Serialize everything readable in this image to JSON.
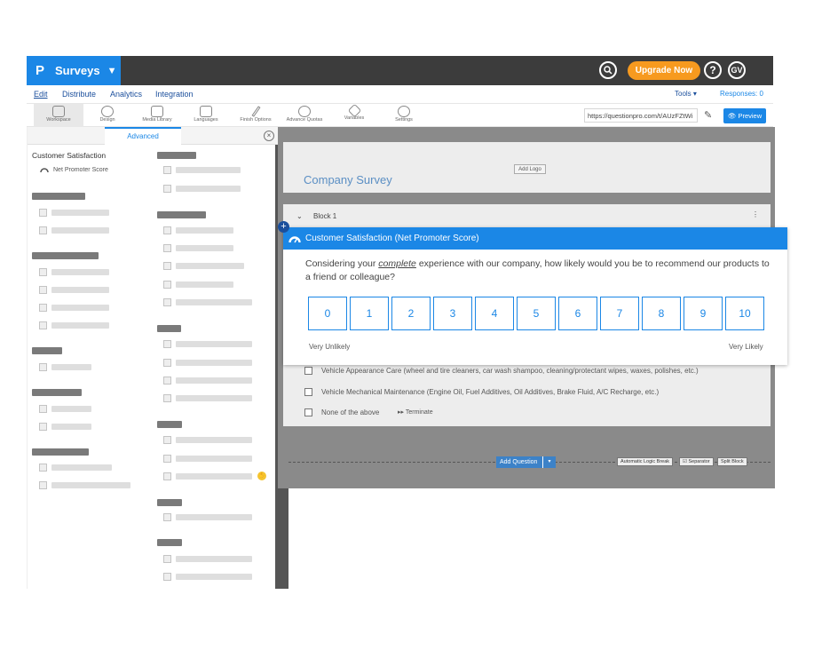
{
  "topbar": {
    "logo_letter": "P",
    "app_name": "Surveys",
    "upgrade_label": "Upgrade Now",
    "help_label": "?",
    "avatar_initials": "GV"
  },
  "nav": {
    "items": [
      "Edit",
      "Distribute",
      "Analytics",
      "Integration"
    ],
    "tools_label": "Tools",
    "responses_label": "Responses: 0"
  },
  "toolbar": {
    "items": [
      "Workspace",
      "Design",
      "Media Library",
      "Languages",
      "Finish Options",
      "Advance Quotas",
      "Variables",
      "Settings"
    ],
    "url": "https://questionpro.com/t/AUzFZtWi",
    "preview_label": "Preview"
  },
  "left_panel": {
    "tab_label": "Advanced",
    "category": "Customer Satisfaction",
    "category_item": "Net Promoter Score"
  },
  "editor": {
    "add_logo_label": "Add Logo",
    "survey_title": "Company Survey",
    "block_label": "Block 1",
    "options": [
      "Vehicle Appearance Care (wheel and tire cleaners, car wash shampoo, cleaning/protectant wipes, waxes, polishes, etc.)",
      "Vehicle Mechanical Maintenance (Engine Oil, Fuel Additives, Oil Additives, Brake Fluid, A/C Recharge, etc.)",
      "None of the above"
    ],
    "terminate_label": "Terminate",
    "add_question_label": "Add Question",
    "logic_break_label": "Automatic Logic Break",
    "separator_label": "Separator",
    "split_block_label": "Split Block"
  },
  "nps_card": {
    "header": "Customer Satisfaction (Net Promoter Score)",
    "question_before": "Considering your ",
    "question_emph": "complete",
    "question_after": " experience with our company, how likely would you be to recommend our products to a friend or colleague?",
    "scale": [
      "0",
      "1",
      "2",
      "3",
      "4",
      "5",
      "6",
      "7",
      "8",
      "9",
      "10"
    ],
    "low_anchor": "Very Unlikely",
    "high_anchor": "Very Likely"
  },
  "colors": {
    "brand_blue": "#1b87e6",
    "upgrade_orange": "#f79a1f",
    "topbar_dark": "#3c3c3c"
  }
}
